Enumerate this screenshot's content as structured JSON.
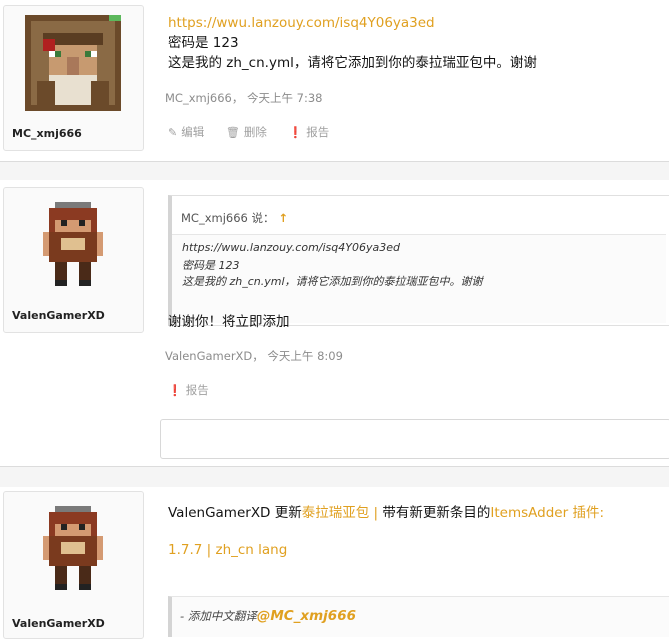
{
  "posts": [
    {
      "username": "MC_xmj666",
      "link": "https://wwu.lanzouy.com/isq4Y06ya3ed",
      "line1": "密码是 123",
      "line2": "这是我的 zh_cn.yml，请将它添加到你的泰拉瑞亚包中。谢谢",
      "meta": "MC_xmj666， 今天上午 7:38",
      "actions": {
        "edit": "编辑",
        "delete": "删除",
        "report": "报告"
      }
    },
    {
      "username": "ValenGamerXD",
      "quote": {
        "author": "MC_xmj666 说：",
        "arrow": "↑",
        "link": "https://wwu.lanzouy.com/isq4Y06ya3ed",
        "line1": "密码是 123",
        "line2": "这是我的 zh_cn.yml，请将它添加到你的泰拉瑞亚包中。谢谢"
      },
      "reply": "谢谢你！将立即添加",
      "meta": "ValenGamerXD， 今天上午 8:09",
      "actions": {
        "report": "报告"
      }
    },
    {
      "username": "ValenGamerXD",
      "update": {
        "prefix": "ValenGamerXD 更新",
        "resource": "泰拉瑞亚包",
        "separator": " | ",
        "middle": "带有新更新条目的",
        "plugin": "ItemsAdder 插件:"
      },
      "version_line": "1.7.7 | zh_cn lang",
      "changelog_prefix": "- 添加中文翻译",
      "changelog_mention": "@MC_xmj666"
    }
  ],
  "colors": {
    "accent": "#e0a020",
    "muted": "#8c8c8c"
  },
  "icons": [
    "pencil-icon",
    "trash-icon",
    "warning-icon"
  ]
}
